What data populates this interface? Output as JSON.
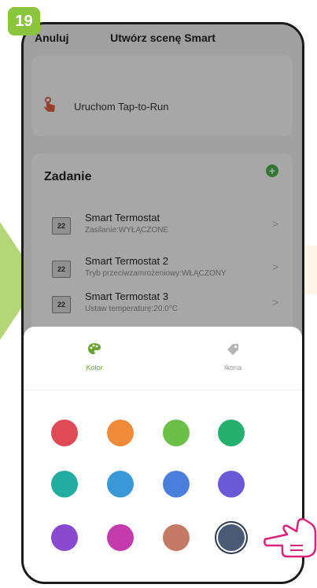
{
  "step": "19",
  "header": {
    "cancel_label": "Anuluj",
    "title": "Utwórz scenę Smart"
  },
  "trigger": {
    "label": "Uruchom Tap-to-Run"
  },
  "task_section": {
    "title": "Zadanie",
    "add_icon": "plus-circle-icon",
    "items": [
      {
        "name": "Smart Termostat",
        "detail": "Zasilanie:WYŁĄCZONE",
        "icon_text": "22"
      },
      {
        "name": "Smart Termostat 2",
        "detail": "Tryb przeciwzamrożeniowy:WŁĄCZONY",
        "icon_text": "22"
      },
      {
        "name": "Smart Termostat 3",
        "detail": "Ustaw temperaturę:20.0°C",
        "icon_text": "22"
      }
    ]
  },
  "bottom_sheet": {
    "tabs": [
      {
        "label": "Kolor",
        "icon": "palette-icon",
        "active": true
      },
      {
        "label": "Ikona",
        "icon": "tag-icon",
        "active": false
      }
    ],
    "colors": [
      "#e04a55",
      "#ee8a3a",
      "#6cc04a",
      "#26b06e",
      "#22ada0",
      "#3a98d8",
      "#4a7fdc",
      "#6a5ad8",
      "#8a4ad0",
      "#c23cae",
      "#c47a66",
      "#4a5a74"
    ],
    "selected_color": "#4a5a74"
  }
}
